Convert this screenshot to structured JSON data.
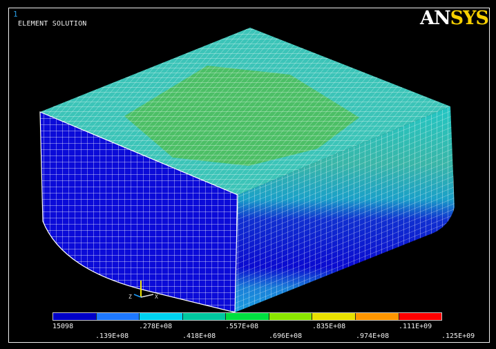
{
  "window": {
    "number": "1"
  },
  "view": {
    "title": "ELEMENT SOLUTION"
  },
  "logo": {
    "part1": "AN",
    "part2": "SYS"
  },
  "legend": {
    "colors": [
      "#0000c8",
      "#1e78ff",
      "#00d2f0",
      "#00c8a0",
      "#00e040",
      "#8ae600",
      "#e8e000",
      "#ff9600",
      "#ff0000"
    ],
    "labels": [
      "15098",
      ".139E+08",
      ".278E+08",
      ".418E+08",
      ".557E+08",
      ".696E+08",
      ".835E+08",
      ".974E+08",
      ".111E+09",
      ".125E+09"
    ]
  },
  "triad": {
    "x": "X",
    "z": "Z"
  }
}
